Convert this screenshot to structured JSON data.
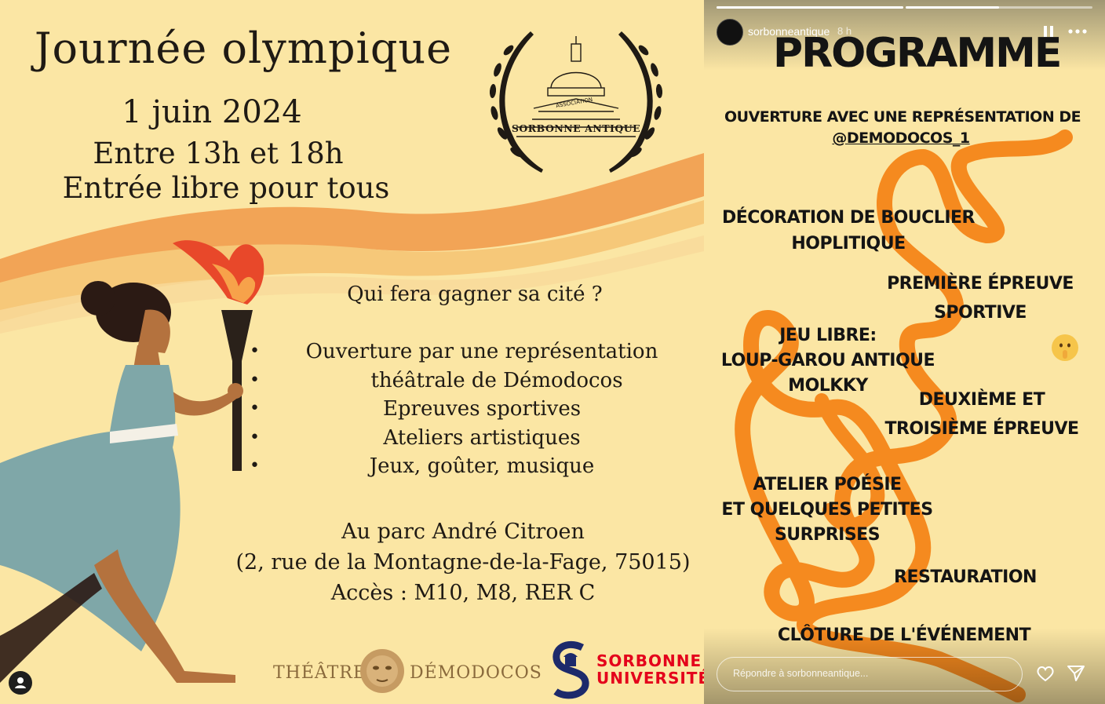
{
  "poster": {
    "title": "Journée olympique",
    "date": "1 juin 2024",
    "hours": "Entre 13h et 18h",
    "entry": "Entrée libre pour tous",
    "emblem": {
      "association_label": "ASSOCIATION",
      "name": "SORBONNE ANTIQUE"
    },
    "question": "Qui fera gagner sa cité ?",
    "list": [
      "Ouverture par une représentation",
      "théâtrale de Démodocos",
      "Epreuves sportives",
      "Ateliers artistiques",
      "Jeux, goûter, musique"
    ],
    "address_1": "Au parc André Citroen",
    "address_2": "(2, rue de la Montagne-de-la-Fage, 75015)",
    "address_3": "Accès : M10, M8, RER C",
    "theatre_left": "THÉÂTRE",
    "theatre_right": "DÉMODOCOS",
    "sorbonne_line_1": "SORBONNE",
    "sorbonne_line_2": "UNIVERSITÉ",
    "colors": {
      "background": "#fbe6a4",
      "wave_1": "#f2a456",
      "wave_2": "#f6c879",
      "flame": "#e8482a",
      "dress": "#7fa7a8"
    }
  },
  "story": {
    "username": "sorbonneantique",
    "time": "8 h",
    "progress": [
      1.0,
      0.5
    ],
    "title": "PROGRAMME",
    "items": {
      "ouverture_1": "OUVERTURE AVEC UNE REPRÉSENTATION DE",
      "ouverture_2": "@DEMODOCOS_1",
      "decoration_1": "DÉCORATION DE BOUCLIER",
      "decoration_2": "HOPLITIQUE",
      "premiere_1": "PREMIÈRE ÉPREUVE",
      "premiere_2": "SPORTIVE",
      "jeu_1": "JEU LIBRE:",
      "jeu_2": "LOUP-GAROU ANTIQUE",
      "jeu_3": "MOLKKY",
      "deuxieme_1": "DEUXIÈME ET",
      "deuxieme_2": "TROISIÈME ÉPREUVE",
      "atelier_1": "ATELIER POÉSIE",
      "atelier_2": "ET QUELQUES PETITES",
      "atelier_3": "SURPRISES",
      "restauration": "RESTAURATION",
      "cloture": "CLÔTURE DE L'ÉVÉNEMENT"
    },
    "reply_placeholder": "Répondre à sorbonneantique...",
    "icons": [
      "pause-icon",
      "more-icon",
      "heart-icon",
      "send-icon",
      "shushing-face-emoji"
    ],
    "colors": {
      "scribble": "#f58a1f",
      "text": "#141414"
    }
  }
}
